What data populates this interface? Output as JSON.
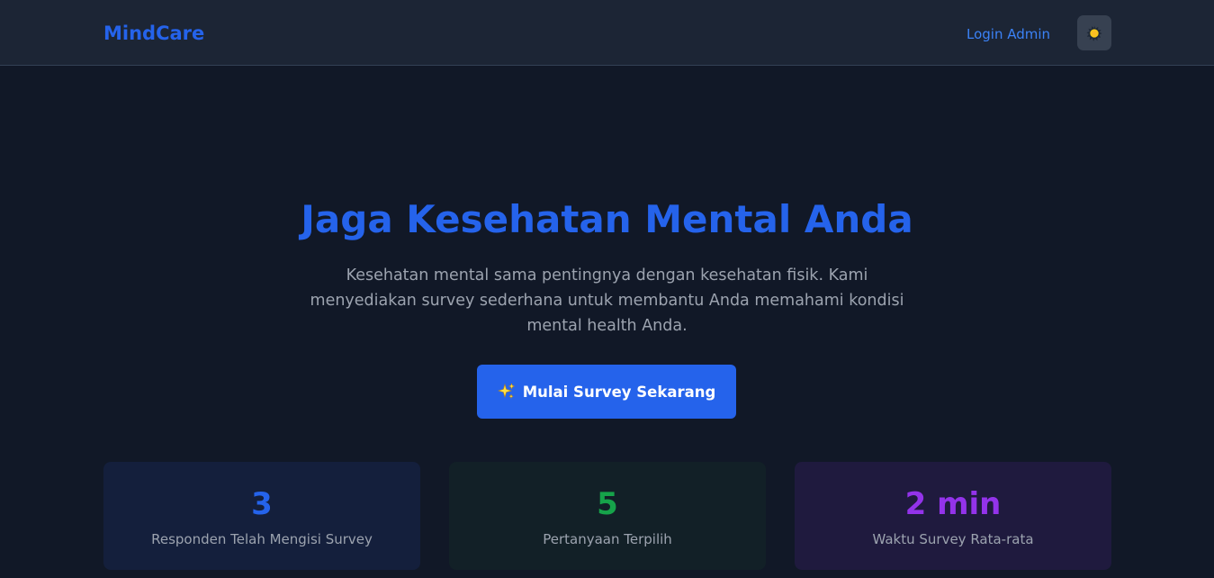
{
  "navbar": {
    "brand": "MindCare",
    "login_label": "Login Admin",
    "theme_toggle_icon": "sun-icon"
  },
  "hero": {
    "title": "Jaga Kesehatan Mental Anda",
    "description": "Kesehatan mental sama pentingnya dengan kesehatan fisik. Kami menyediakan survey sederhana untuk membantu Anda memahami kondisi mental health Anda.",
    "cta_label": "Mulai Survey Sekarang",
    "cta_icon": "sparkle-icon"
  },
  "stats": [
    {
      "value": "3",
      "label": "Responden Telah Mengisi Survey",
      "color": "#2563eb"
    },
    {
      "value": "5",
      "label": "Pertanyaan Terpilih",
      "color": "#16a34a"
    },
    {
      "value": "2 min",
      "label": "Waktu Survey Rata-rata",
      "color": "#9333ea"
    }
  ],
  "colors": {
    "background": "#111827",
    "navbar": "#1c2535",
    "accent": "#2563eb",
    "muted_text": "#9ca3af"
  }
}
